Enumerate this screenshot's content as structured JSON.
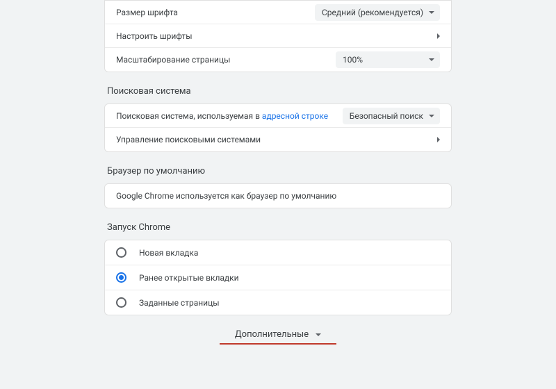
{
  "appearance": {
    "font_size_label": "Размер шрифта",
    "font_size_value": "Средний (рекомендуется)",
    "customize_fonts": "Настроить шрифты",
    "page_zoom_label": "Масштабирование страницы",
    "page_zoom_value": "100%"
  },
  "search": {
    "title": "Поисковая система",
    "engine_label_prefix": "Поисковая система, используемая в ",
    "engine_label_link": "адресной строке",
    "engine_value": "Безопасный поиск",
    "manage": "Управление поисковыми системами"
  },
  "default_browser": {
    "title": "Браузер по умолчанию",
    "info": "Google Chrome используется как браузер по умолчанию"
  },
  "startup": {
    "title": "Запуск Chrome",
    "options": [
      {
        "label": "Новая вкладка",
        "selected": false
      },
      {
        "label": "Ранее открытые вкладки",
        "selected": true
      },
      {
        "label": "Заданные страницы",
        "selected": false
      }
    ]
  },
  "advanced_label": "Дополнительные"
}
